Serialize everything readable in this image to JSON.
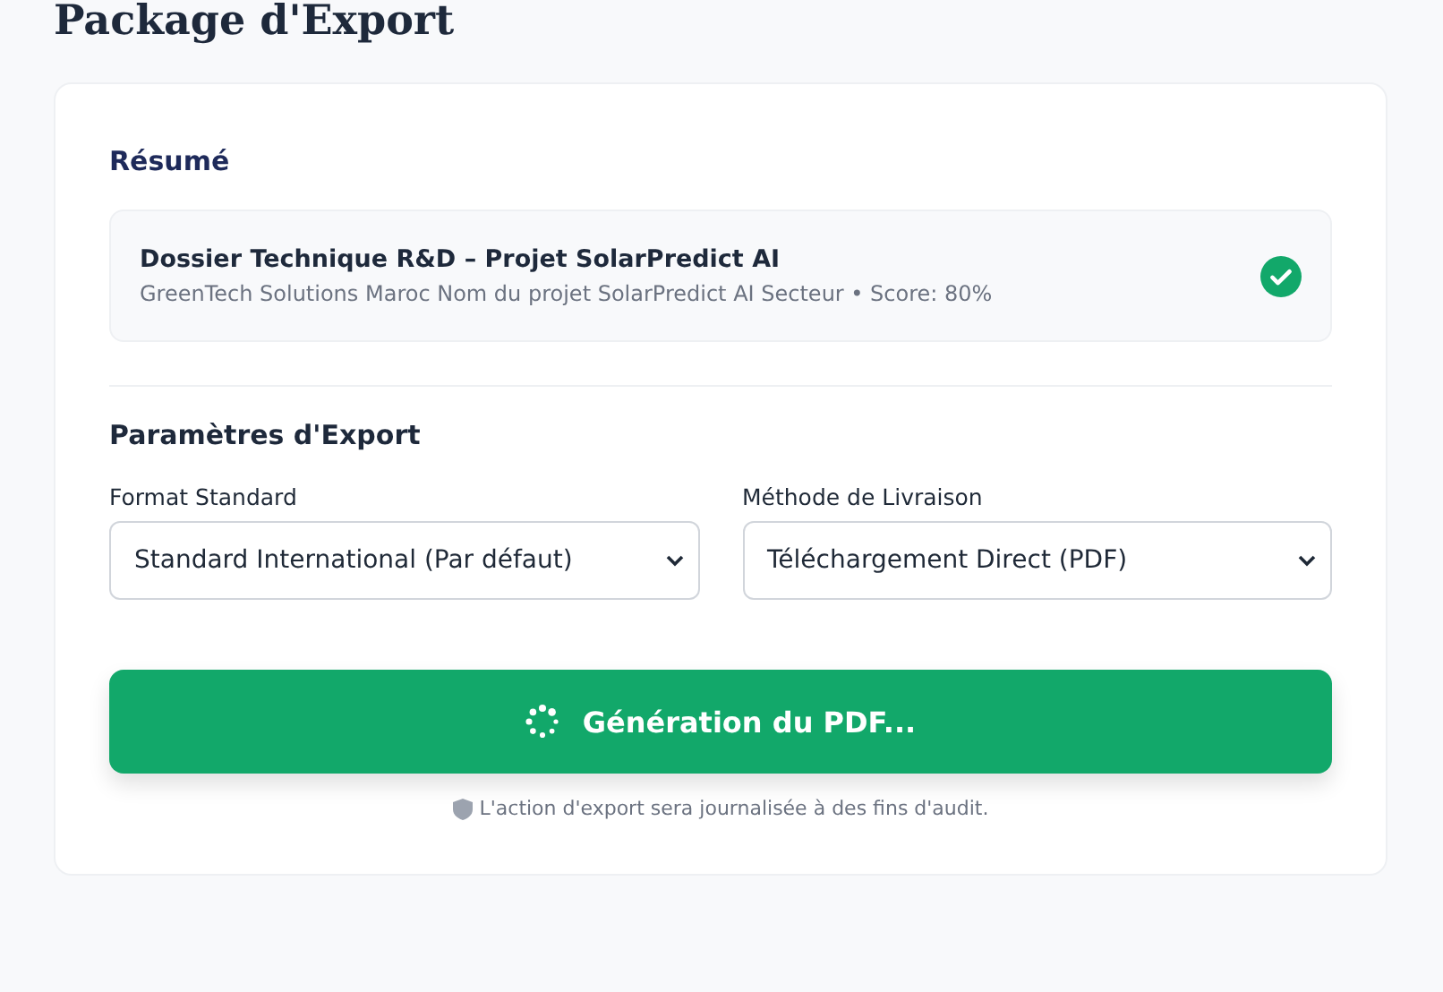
{
  "page_title": "Package d'Export",
  "summary": {
    "heading": "Résumé",
    "title": "Dossier Technique R&D – Projet SolarPredict AI",
    "subtitle": "GreenTech Solutions Maroc Nom du projet SolarPredict AI Secteur • Score: 80%",
    "verified": true
  },
  "settings": {
    "heading": "Paramètres d'Export",
    "fields": [
      {
        "label": "Format Standard",
        "value": "Standard International (Par défaut)"
      },
      {
        "label": "Méthode de Livraison",
        "value": "Téléchargement Direct (PDF)"
      }
    ]
  },
  "generate_button": {
    "label": "Génération du PDF...",
    "loading": true
  },
  "audit_note": "L'action d'export sera journalisée à des fins d'audit."
}
